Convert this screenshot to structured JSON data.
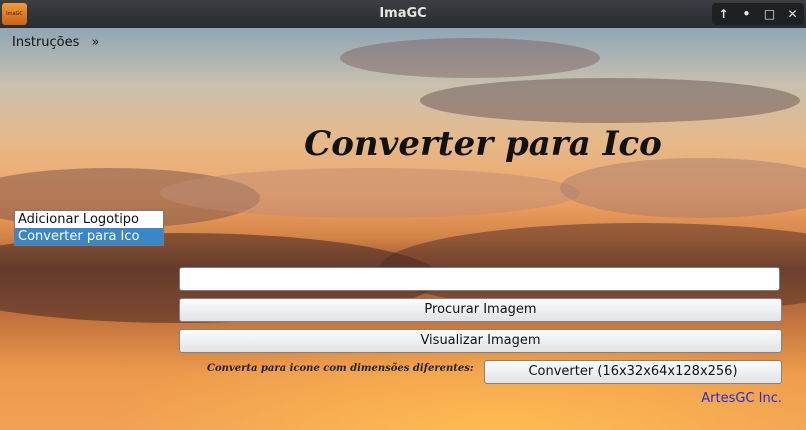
{
  "window": {
    "title": "ImaGC",
    "app_icon_text": "ImaGC",
    "controls": [
      "↑",
      "•",
      "□",
      "✕"
    ]
  },
  "menubar": {
    "instrucoes": "Instruções",
    "more": "»"
  },
  "heading": "Converter para Ico",
  "list": {
    "items": [
      "Adicionar Logotipo",
      "Converter para Ico"
    ],
    "selected": "Converter para Ico"
  },
  "path_input": {
    "value": "",
    "placeholder": ""
  },
  "buttons": {
    "procurar": "Procurar Imagem",
    "visualizar": "Visualizar Imagem",
    "converter": "Converter (16x32x64x128x256)"
  },
  "note": "Converta para icone com dimensões diferentes:",
  "company": "ArtesGC Inc.",
  "colors": {
    "selection": "#3b86c6",
    "company_text": "#2a2ad0"
  }
}
